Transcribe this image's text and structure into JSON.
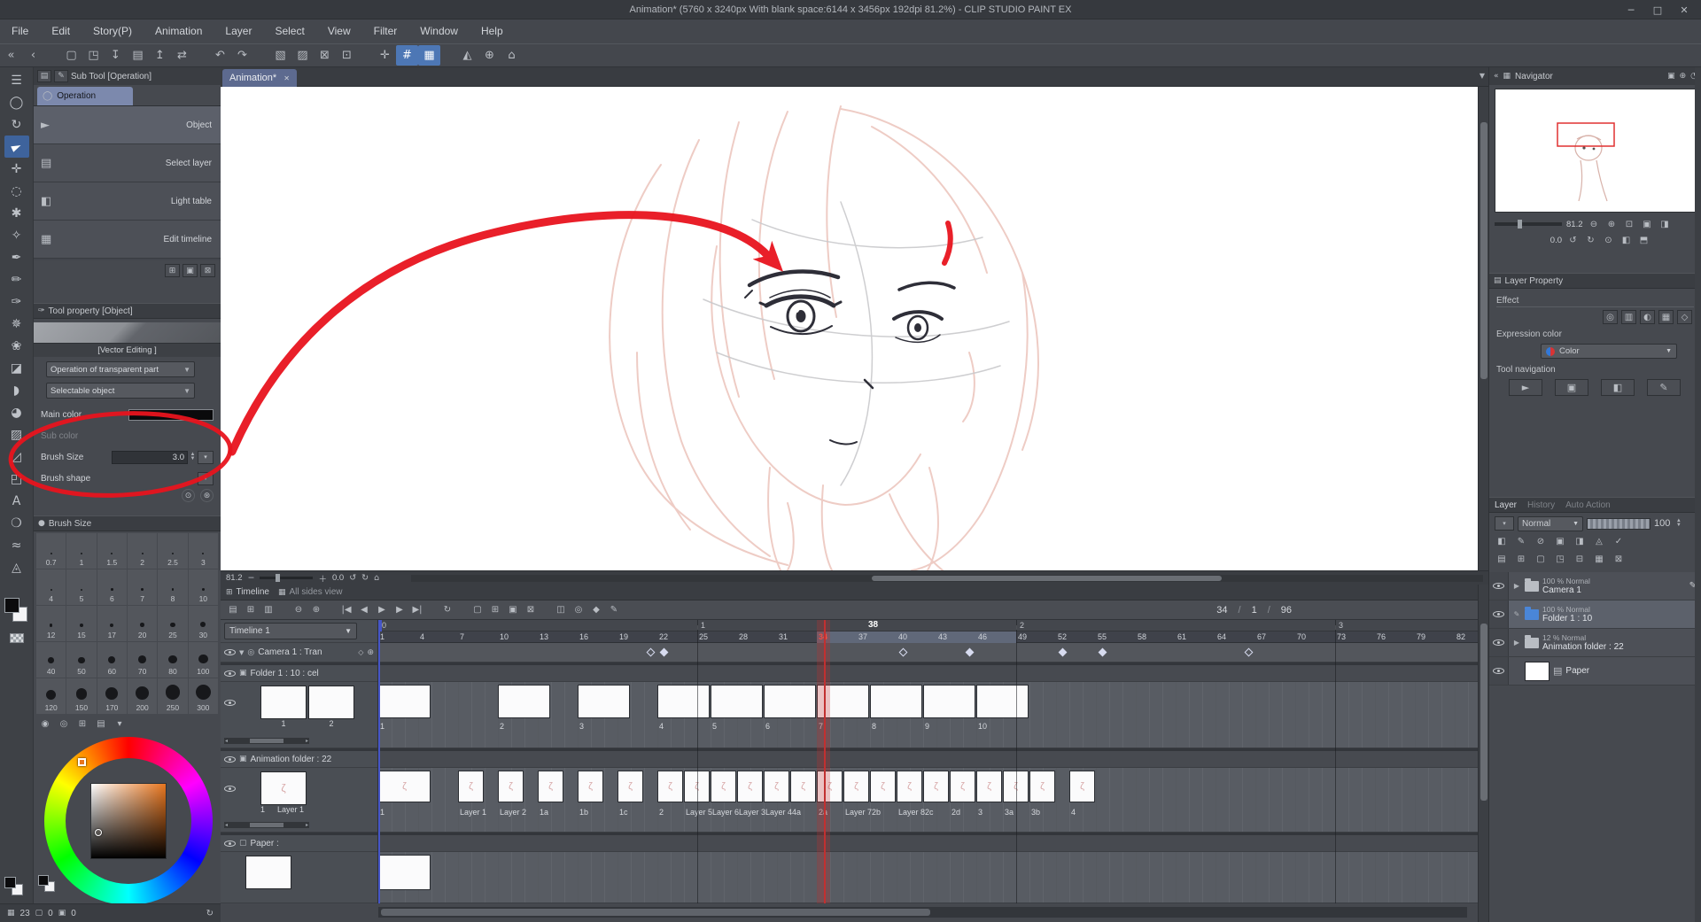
{
  "window": {
    "title": "Animation* (5760 x 3240px With blank space:6144 x 3456px 192dpi 81.2%)  - CLIP STUDIO PAINT EX",
    "buttons": [
      {
        "name": "minimize",
        "glyph": "─"
      },
      {
        "name": "maximize",
        "glyph": "□"
      },
      {
        "name": "close",
        "glyph": "✕"
      }
    ]
  },
  "menu_bar": {
    "items": [
      "File",
      "Edit",
      "Story(P)",
      "Animation",
      "Layer",
      "Select",
      "View",
      "Filter",
      "Window",
      "Help"
    ]
  },
  "toolbar": {
    "groups": [
      {
        "name": "nav",
        "items": [
          {
            "name": "collapse-left",
            "glyph": "«"
          },
          {
            "name": "history-back",
            "glyph": "‹"
          }
        ]
      },
      {
        "name": "file",
        "items": [
          {
            "name": "new",
            "glyph": "▢"
          },
          {
            "name": "open",
            "glyph": "◳"
          },
          {
            "name": "save",
            "glyph": "↧"
          },
          {
            "name": "print",
            "glyph": "▤"
          },
          {
            "name": "import",
            "glyph": "↥"
          },
          {
            "name": "export",
            "glyph": "⇄"
          }
        ]
      },
      {
        "name": "undo",
        "items": [
          {
            "name": "undo",
            "glyph": "↶"
          },
          {
            "name": "redo",
            "glyph": "↷"
          }
        ]
      },
      {
        "name": "select",
        "items": [
          {
            "name": "deselect",
            "glyph": "▧"
          },
          {
            "name": "reselect",
            "glyph": "▨"
          },
          {
            "name": "invert-selection",
            "glyph": "⊠"
          },
          {
            "name": "selection-border",
            "glyph": "⊡"
          }
        ]
      },
      {
        "name": "snap",
        "items": [
          {
            "name": "snap-ruler",
            "glyph": "✛"
          },
          {
            "name": "snap-special-ruler",
            "glyph": "#",
            "on": true
          },
          {
            "name": "snap-grid",
            "glyph": "▦",
            "on": true
          }
        ]
      },
      {
        "name": "view",
        "items": [
          {
            "name": "symmetry",
            "glyph": "◭"
          },
          {
            "name": "zoom-fit",
            "glyph": "⊕"
          },
          {
            "name": "reset-view",
            "glyph": "⌂"
          }
        ]
      }
    ]
  },
  "tool_strip": {
    "tools": [
      {
        "name": "palette-menu",
        "glyph": "☰"
      },
      {
        "name": "zoom-tool",
        "glyph": "◯"
      },
      {
        "name": "rotate-canvas-tool",
        "glyph": "↻"
      },
      {
        "name": "operation-tool",
        "glyph": "►",
        "selected": true,
        "cursor": true
      },
      {
        "name": "move-layer-tool",
        "glyph": "✛"
      },
      {
        "name": "selection-tool",
        "glyph": "◌"
      },
      {
        "name": "auto-select-tool",
        "glyph": "✱"
      },
      {
        "name": "eyedropper-tool",
        "glyph": "✧"
      },
      {
        "name": "pen-tool",
        "glyph": "✒"
      },
      {
        "name": "pencil-tool",
        "glyph": "✏"
      },
      {
        "name": "brush-tool",
        "glyph": "✑"
      },
      {
        "name": "airbrush-tool",
        "glyph": "✵"
      },
      {
        "name": "decoration-tool",
        "glyph": "❀"
      },
      {
        "name": "eraser-tool",
        "glyph": "◪"
      },
      {
        "name": "blend-tool",
        "glyph": "◗"
      },
      {
        "name": "fill-tool",
        "glyph": "◕"
      },
      {
        "name": "gradient-tool",
        "glyph": "▨"
      },
      {
        "name": "figure-tool",
        "glyph": "◿"
      },
      {
        "name": "frame-border-tool",
        "glyph": "◰"
      },
      {
        "name": "text-tool",
        "glyph": "A"
      },
      {
        "name": "balloon-tool",
        "glyph": "❍"
      },
      {
        "name": "correct-line-tool",
        "glyph": "≈"
      },
      {
        "name": "ruler-tool",
        "glyph": "◬"
      }
    ]
  },
  "sub_tool": {
    "panel_title": "Sub Tool [Operation]",
    "group_tab": "Operation",
    "items": [
      {
        "label": "Object",
        "glyph": "►",
        "selected": true
      },
      {
        "label": "Select layer",
        "glyph": "▤"
      },
      {
        "label": "Light table",
        "glyph": "◧"
      },
      {
        "label": "Edit timeline",
        "glyph": "▦"
      }
    ],
    "buttons": [
      {
        "name": "add-subtool",
        "glyph": "⊞"
      },
      {
        "name": "duplicate-subtool",
        "glyph": "▣"
      },
      {
        "name": "delete-subtool",
        "glyph": "⊠"
      }
    ]
  },
  "tool_property": {
    "panel_title": "Tool property [Object]",
    "preview_caption": "[Vector Editing ]",
    "dropdown1": "Operation of transparent part",
    "dropdown2": "Selectable object",
    "main_color_label": "Main color",
    "sub_color_label": "Sub color",
    "brush_size_label": "Brush Size",
    "brush_size_value": "3.0",
    "brush_shape_label": "Brush shape"
  },
  "brush_size_panel": {
    "title": "Brush Size",
    "sizes": [
      "0.7",
      "1",
      "1.5",
      "2",
      "2.5",
      "3",
      "4",
      "5",
      "6",
      "7",
      "8",
      "10",
      "12",
      "15",
      "17",
      "20",
      "25",
      "30",
      "40",
      "50",
      "60",
      "70",
      "80",
      "100",
      "120",
      "150",
      "170",
      "200",
      "250",
      "300"
    ]
  },
  "color_wheel": {
    "icons": [
      {
        "name": "color-wheel-tab",
        "glyph": "◉"
      },
      {
        "name": "color-slider-tab",
        "glyph": "◎"
      },
      {
        "name": "color-set-tab",
        "glyph": "⊞"
      },
      {
        "name": "mixing-palette-tab",
        "glyph": "▤"
      },
      {
        "name": "wheel-menu",
        "glyph": "▾"
      }
    ]
  },
  "status_bar": {
    "v1": "23",
    "v2": "0",
    "v3": "0"
  },
  "canvas": {
    "tab": "Animation*",
    "zoom": "81.2",
    "rotation": "0.0"
  },
  "timeline": {
    "tab_title": "Timeline",
    "all_sides_view": "All sides view",
    "timeline_select": "Timeline 1",
    "frame_counter": {
      "current": "34",
      "start": "1",
      "end": "96"
    },
    "ppf": 15,
    "total_frames": 82,
    "ruler_step": 3,
    "current_frame": 34,
    "start_marker_frame": 1,
    "highlight": {
      "from": 34,
      "to": 48
    },
    "second_label": {
      "frame": 38,
      "text": "38"
    },
    "seconds": [
      {
        "frame": 1,
        "text": "0"
      },
      {
        "frame": 25,
        "text": "1"
      },
      {
        "frame": 49,
        "text": "2"
      },
      {
        "frame": 73,
        "text": "3"
      }
    ],
    "toolbar_groups": [
      {
        "items": [
          {
            "name": "timeline-menu",
            "glyph": "▤"
          },
          {
            "name": "new-timeline",
            "glyph": "⊞"
          },
          {
            "name": "timeline-settings",
            "glyph": "▥"
          }
        ]
      },
      {
        "items": [
          {
            "name": "zoom-out-timeline",
            "glyph": "⊖"
          },
          {
            "name": "zoom-in-timeline",
            "glyph": "⊕"
          }
        ]
      },
      {
        "items": [
          {
            "name": "go-first-frame",
            "glyph": "|◀"
          },
          {
            "name": "prev-frame",
            "glyph": "◀"
          },
          {
            "name": "play",
            "glyph": "▶"
          },
          {
            "name": "next-frame",
            "glyph": "▶"
          },
          {
            "name": "go-last-frame",
            "glyph": "▶|"
          }
        ]
      },
      {
        "items": [
          {
            "name": "loop-play",
            "glyph": "↻"
          }
        ]
      },
      {
        "items": [
          {
            "name": "new-animation-cel",
            "glyph": "▢"
          },
          {
            "name": "specify-cels",
            "glyph": "⊞"
          },
          {
            "name": "new-animation-folder",
            "glyph": "▣"
          },
          {
            "name": "delete-cel",
            "glyph": "⊠"
          }
        ]
      },
      {
        "items": [
          {
            "name": "onion-skin",
            "glyph": "◫"
          },
          {
            "name": "camera-2d",
            "glyph": "◎"
          },
          {
            "name": "enable-keyframes",
            "glyph": "◆"
          },
          {
            "name": "edit-keyframe",
            "glyph": "✎"
          }
        ]
      }
    ],
    "tracks": {
      "camera": {
        "label": "Camera 1 : Tran",
        "keyframes": [
          {
            "frame": 21,
            "filled": false
          },
          {
            "frame": 22,
            "filled": true
          },
          {
            "frame": 40,
            "filled": false
          },
          {
            "frame": 45,
            "filled": true
          },
          {
            "frame": 52,
            "filled": true
          },
          {
            "frame": 55,
            "filled": true
          },
          {
            "frame": 66,
            "filled": false
          }
        ]
      },
      "folder1": {
        "label": "Folder 1 : 10 : cel",
        "thumbs": [
          "1",
          "2"
        ],
        "cels": [
          {
            "frame": 1,
            "len": 4,
            "name": "1"
          },
          {
            "frame": 10,
            "len": 4,
            "name": "2"
          },
          {
            "frame": 16,
            "len": 4,
            "name": "3"
          },
          {
            "frame": 22,
            "len": 4,
            "name": "4"
          },
          {
            "frame": 26,
            "len": 4,
            "name": "5"
          },
          {
            "frame": 30,
            "len": 4,
            "name": "6"
          },
          {
            "frame": 34,
            "len": 4,
            "name": "7"
          },
          {
            "frame": 38,
            "len": 4,
            "name": "8"
          },
          {
            "frame": 42,
            "len": 4,
            "name": "9"
          },
          {
            "frame": 46,
            "len": 4,
            "name": "10"
          }
        ]
      },
      "anim": {
        "label": "Animation folder : 22",
        "thumb_num": "1",
        "thumb_name": "Layer 1",
        "cels": [
          {
            "frame": 1,
            "len": 4,
            "name": "1",
            "fig": true
          },
          {
            "frame": 7,
            "len": 2,
            "name": "Layer 1",
            "fig": true
          },
          {
            "frame": 10,
            "len": 2,
            "name": "Layer 2",
            "fig": true
          },
          {
            "frame": 13,
            "len": 2,
            "name": "1a",
            "fig": true
          },
          {
            "frame": 16,
            "len": 2,
            "name": "1b",
            "fig": true
          },
          {
            "frame": 19,
            "len": 2,
            "name": "1c",
            "fig": true
          },
          {
            "frame": 22,
            "len": 2,
            "name": "2",
            "fig": true
          },
          {
            "frame": 24,
            "len": 2,
            "name": "Layer 5",
            "fig": true
          },
          {
            "frame": 26,
            "len": 2,
            "name": "Layer 6",
            "fig": true
          },
          {
            "frame": 28,
            "len": 2,
            "name": "Layer 3",
            "fig": true
          },
          {
            "frame": 30,
            "len": 2,
            "name": "Layer 4",
            "fig": true
          },
          {
            "frame": 32,
            "len": 2,
            "name": "4a",
            "fig": true
          },
          {
            "frame": 34,
            "len": 2,
            "name": "2a",
            "fig": true
          },
          {
            "frame": 36,
            "len": 2,
            "name": "Layer 7",
            "fig": true
          },
          {
            "frame": 38,
            "len": 2,
            "name": "2b",
            "fig": true
          },
          {
            "frame": 40,
            "len": 2,
            "name": "Layer 8",
            "fig": true
          },
          {
            "frame": 42,
            "len": 2,
            "name": "2c",
            "fig": true
          },
          {
            "frame": 44,
            "len": 2,
            "name": "2d",
            "fig": true
          },
          {
            "frame": 46,
            "len": 2,
            "name": "3",
            "fig": true
          },
          {
            "frame": 48,
            "len": 2,
            "name": "3a",
            "fig": true
          },
          {
            "frame": 50,
            "len": 2,
            "name": "3b",
            "fig": true
          },
          {
            "frame": 53,
            "len": 2,
            "name": "4",
            "fig": true
          }
        ]
      },
      "paper": {
        "label": "Paper :",
        "cels": [
          {
            "frame": 1,
            "len": 4,
            "name": ""
          }
        ]
      }
    }
  },
  "navigator": {
    "title": "Navigator",
    "zoom": "81.2",
    "rotation": "0.0"
  },
  "layer_property": {
    "title": "Layer Property",
    "effect": "Effect",
    "effect_icons": [
      {
        "name": "border-effect-icon",
        "glyph": "◎"
      },
      {
        "name": "tone-icon",
        "glyph": "▥"
      },
      {
        "name": "layer-color-icon",
        "glyph": "◐"
      },
      {
        "name": "extract-line-icon",
        "glyph": "▦"
      },
      {
        "name": "expression-icon",
        "glyph": "◇"
      }
    ],
    "expression": "Expression color",
    "expression_value": "Color",
    "tool_navigation": "Tool navigation",
    "tool_nav_icons": [
      {
        "name": "nav-object-icon",
        "glyph": "►"
      },
      {
        "name": "nav-select-layer-icon",
        "glyph": "▣"
      },
      {
        "name": "nav-light-table-icon",
        "glyph": "◧"
      },
      {
        "name": "nav-edit-timeline-icon",
        "glyph": "✎"
      }
    ]
  },
  "layer_panel": {
    "tabs": [
      "Layer",
      "History",
      "Auto Action"
    ],
    "blend_mode": "Normal",
    "opacity": "100",
    "icons_row1": [
      {
        "name": "clip-mask-icon",
        "glyph": "◧"
      },
      {
        "name": "draft-icon",
        "glyph": "✎"
      },
      {
        "name": "lock-layer-icon",
        "glyph": "⊘"
      },
      {
        "name": "lock-transparent-icon",
        "glyph": "▣"
      },
      {
        "name": "mask-icon",
        "glyph": "◨"
      },
      {
        "name": "ruler-range-icon",
        "glyph": "◬"
      },
      {
        "name": "set-as-reference-icon",
        "glyph": "✓"
      }
    ],
    "icons_row2": [
      {
        "name": "layer-menu-icon",
        "glyph": "▤"
      },
      {
        "name": "new-layer-icon",
        "glyph": "⊞"
      },
      {
        "name": "new-vector-layer-icon",
        "glyph": "▢"
      },
      {
        "name": "new-folder-icon",
        "glyph": "◳"
      },
      {
        "name": "merge-below-icon",
        "glyph": "⊟"
      },
      {
        "name": "layer-mask-icon",
        "glyph": "▦"
      },
      {
        "name": "delete-layer-icon",
        "glyph": "⊠"
      }
    ],
    "layers": [
      {
        "info": "100 % Normal",
        "name": "Camera 1",
        "icon": "folder",
        "expand": true,
        "pen": true
      },
      {
        "info": "100 % Normal",
        "name": "Folder 1 : 10",
        "icon": "folder-blue",
        "pencil": true,
        "selected": true
      },
      {
        "info": "12 % Normal",
        "name": "Animation folder : 22",
        "icon": "folder",
        "expand": true
      },
      {
        "info": "",
        "name": "Paper",
        "icon": "paper",
        "thumb": true
      }
    ]
  },
  "annotation": {
    "color": "#e8141e"
  }
}
